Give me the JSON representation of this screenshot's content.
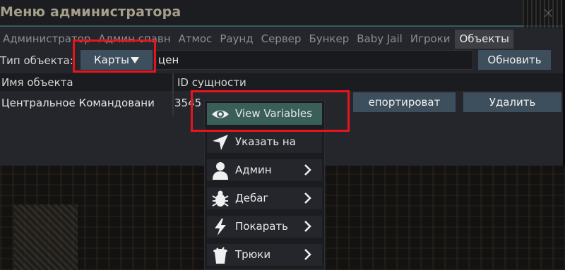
{
  "window": {
    "title": "Меню администратора",
    "close_glyph": "×"
  },
  "tabs": [
    {
      "label": "Администратор",
      "active": false
    },
    {
      "label": "Админ спавн",
      "active": false
    },
    {
      "label": "Атмос",
      "active": false
    },
    {
      "label": "Раунд",
      "active": false
    },
    {
      "label": "Сервер",
      "active": false
    },
    {
      "label": "Бункер",
      "active": false
    },
    {
      "label": "Baby Jail",
      "active": false
    },
    {
      "label": "Игроки",
      "active": false
    },
    {
      "label": "Объекты",
      "active": true
    }
  ],
  "filter": {
    "type_label": "Тип объекта:",
    "type_value": "Карты",
    "search_value": "цен",
    "refresh_label": "Обновить"
  },
  "table": {
    "columns": [
      "Имя объекта",
      "ID сущности"
    ],
    "rows": [
      {
        "name": "Центральное Командовани",
        "id": "3545",
        "export_label": "епортироват",
        "delete_label": "Удалить"
      }
    ]
  },
  "context_menu": {
    "items": [
      {
        "label": "View Variables",
        "icon": "eye-icon",
        "submenu": false,
        "highlighted": true
      },
      {
        "label": "Указать на",
        "icon": "pointer-arrow-icon",
        "submenu": false,
        "highlighted": false
      },
      {
        "label": "Админ",
        "icon": "person-icon",
        "submenu": true,
        "highlighted": false
      },
      {
        "label": "Дебаг",
        "icon": "bug-icon",
        "submenu": true,
        "highlighted": false
      },
      {
        "label": "Покарать",
        "icon": "lightning-icon",
        "submenu": true,
        "highlighted": false
      },
      {
        "label": "Трюки",
        "icon": "magic-hat-icon",
        "submenu": true,
        "highlighted": false
      }
    ]
  },
  "colors": {
    "window_bg": "#25262b",
    "title_text": "#a59e89",
    "button_bg": "#3d4f5c",
    "menu_highlight": "#3a5f5a",
    "annotation_red": "#e8141d"
  }
}
